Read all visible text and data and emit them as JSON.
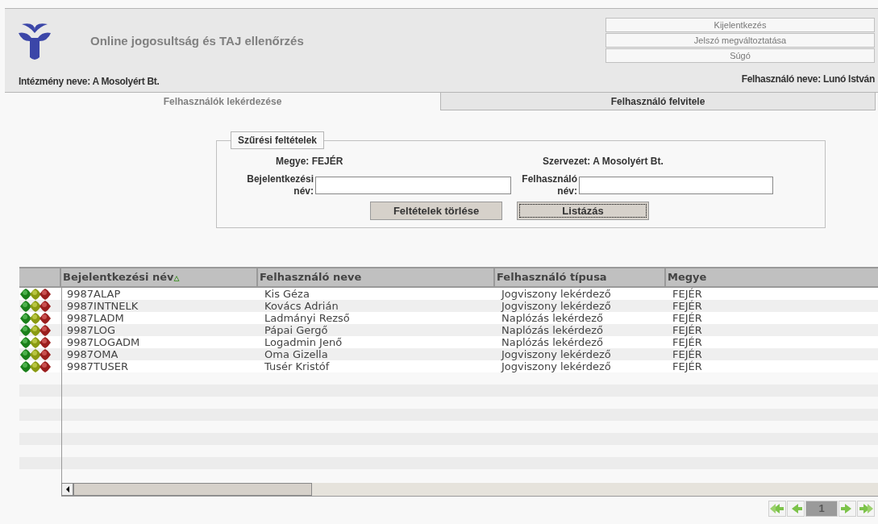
{
  "header": {
    "title": "Online jogosultság és TAJ ellenőrzés",
    "institution": "Intézmény neve: A Mosolyért Bt.",
    "user": "Felhasználó neve: Lunó István",
    "links": [
      "Kijelentkezés",
      "Jelszó megváltoztatása",
      "Súgó"
    ]
  },
  "tabs": [
    {
      "label": "Felhasználók lekérdezése",
      "selected": true
    },
    {
      "label": "Felhasználó felvitele",
      "selected": false
    }
  ],
  "filter": {
    "legend": "Szűrési feltételek",
    "county": "Megye: FEJÉR",
    "organization": "Szervezet: A Mosolyért Bt.",
    "login_label": "Bejelentkezési név:",
    "user_label": "Felhasználó név:",
    "buttons": [
      "Feltételek törlése",
      "Listázás"
    ]
  },
  "table": {
    "columns": [
      "Bejelentkezési név",
      "Felhasználó neve",
      "Felhasználó típusa",
      "Megye"
    ],
    "sort_icon": "▵",
    "rows": [
      [
        "9987ALAP",
        "Kis Géza",
        "Jogviszony lekérdező",
        "FEJÉR"
      ],
      [
        "9987INTNELK",
        "Kovács Adrián",
        "Jogviszony lekérdező",
        "FEJÉR"
      ],
      [
        "9987LADM",
        "Ladmányi Rezső",
        "Naplózás lekérdező",
        "FEJÉR"
      ],
      [
        "9987LOG",
        "Pápai Gergő",
        "Naplózás lekérdező",
        "FEJÉR"
      ],
      [
        "9987LOGADM",
        "Logadmin Jenő",
        "Naplózás lekérdező",
        "FEJÉR"
      ],
      [
        "9987OMA",
        "Oma Gizella",
        "Jogviszony lekérdező",
        "FEJÉR"
      ],
      [
        "9987TUSER",
        "Tusér Kristóf",
        "Jogviszony lekérdező",
        "FEJÉR"
      ]
    ]
  },
  "pager": {
    "page": "1"
  }
}
